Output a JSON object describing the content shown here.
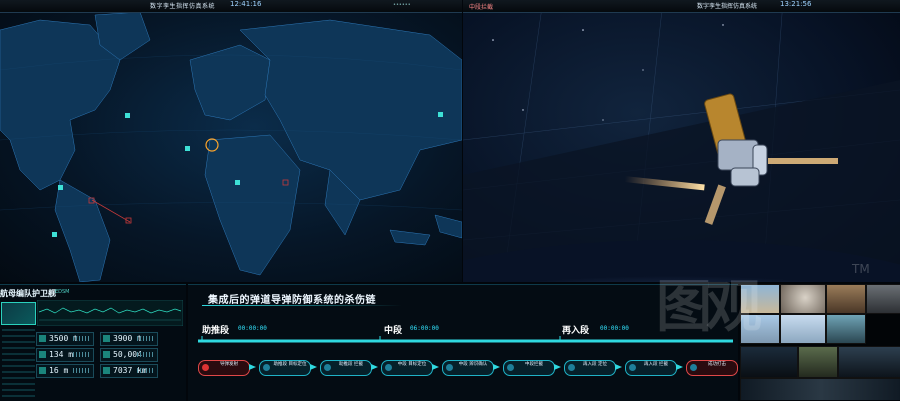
{
  "map_panel": {
    "title": "数字孪生指挥仿真系统",
    "clock": "12:41:16",
    "pip_label": "••••••"
  },
  "space_panel": {
    "scene_label": "中段拦截",
    "title": "数字孪生指挥仿真系统",
    "clock": "13:21:56"
  },
  "fleet_panel": {
    "header": "航母编队护卫舰",
    "subheader": "EDSM",
    "readouts": [
      {
        "value": "3500 t"
      },
      {
        "value": "3900 t"
      },
      {
        "value": "134 m"
      },
      {
        "value": "50,004"
      },
      {
        "value": "16 m"
      },
      {
        "value": "7037 km"
      }
    ]
  },
  "kill_chain": {
    "title": "集成后的弹道导弹防御系统的杀伤链",
    "phases": [
      {
        "label": "助推段",
        "time": "00:00:00"
      },
      {
        "label": "中段",
        "time": "06:00:00"
      },
      {
        "label": "再入段",
        "time": "00:00:00"
      }
    ],
    "nodes": [
      {
        "label": "导弹发射"
      },
      {
        "label": "助推段 目标定位"
      },
      {
        "label": "助推段 拦截"
      },
      {
        "label": "中段 目标定位"
      },
      {
        "label": "中段 辨识确认"
      },
      {
        "label": "中段拦截"
      },
      {
        "label": "再入段 定位"
      },
      {
        "label": "再入段 拦截"
      },
      {
        "label": "成功打击"
      }
    ]
  },
  "watermark": "图观",
  "trademark": "TM",
  "colors": {
    "accent": "#2fd9e0",
    "alert": "#e04848",
    "panel_bg": "#040c13"
  }
}
